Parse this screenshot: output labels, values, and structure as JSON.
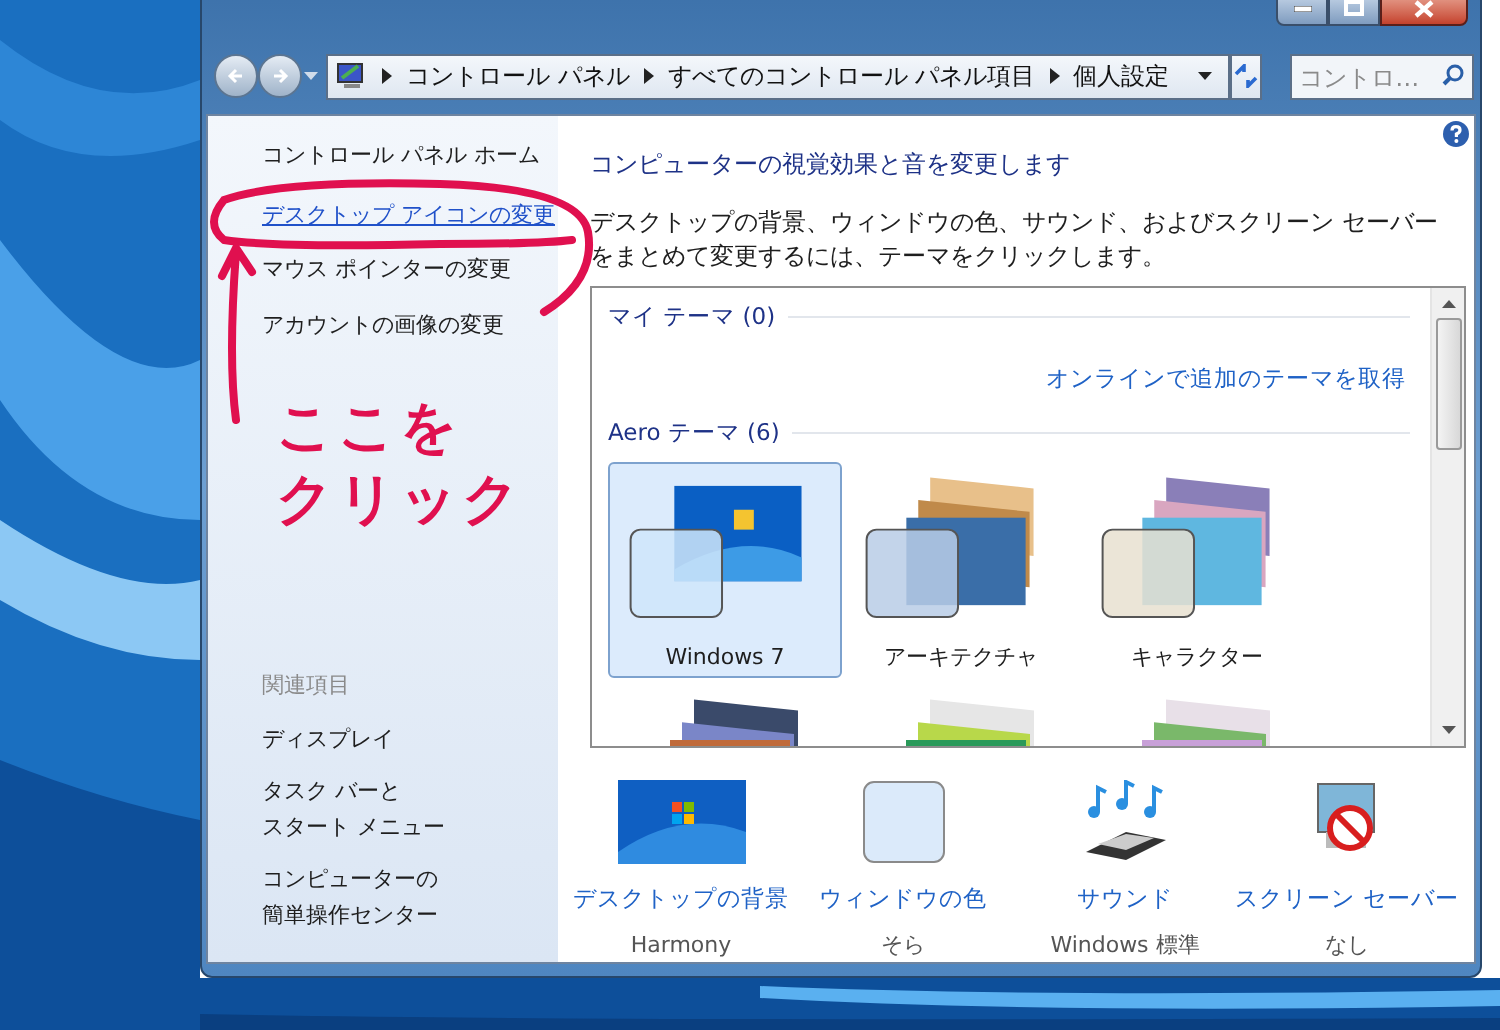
{
  "window": {
    "breadcrumb": [
      "コントロール パネル",
      "すべてのコントロール パネル項目",
      "個人設定"
    ],
    "search": {
      "placeholder": "コントロ…"
    }
  },
  "sidebar": {
    "home_link": "コントロール パネル ホーム",
    "tasks": [
      {
        "label": "デスクトップ アイコンの変更",
        "hovered": true
      },
      {
        "label": "マウス ポインターの変更",
        "hovered": false
      },
      {
        "label": "アカウントの画像の変更",
        "hovered": false
      }
    ],
    "related": {
      "heading": "関連項目",
      "links": [
        {
          "lines": [
            "ディスプレイ"
          ]
        },
        {
          "lines": [
            "タスク バーと",
            "スタート メニュー"
          ]
        },
        {
          "lines": [
            "コンピューターの",
            "簡単操作センター"
          ]
        }
      ]
    }
  },
  "main": {
    "title": "コンピューターの視覚効果と音を変更します",
    "description": "デスクトップの背景、ウィンドウの色、サウンド、およびスクリーン セーバーをまとめて変更するには、テーマをクリックします。",
    "my_themes_heading": "マイ テーマ (0)",
    "online_link": "オンラインで追加のテーマを取得",
    "aero_heading": "Aero テーマ (6)",
    "themes": [
      {
        "name": "Windows 7",
        "selected": true
      },
      {
        "name": "アーキテクチャ",
        "selected": false
      },
      {
        "name": "キャラクター",
        "selected": false
      },
      {
        "selected": false
      },
      {
        "selected": false
      },
      {
        "selected": false
      }
    ]
  },
  "settings": [
    {
      "kind": "background",
      "label": "デスクトップの背景",
      "value": "Harmony"
    },
    {
      "kind": "color",
      "label": "ウィンドウの色",
      "value": "そら"
    },
    {
      "kind": "sound",
      "label": "サウンド",
      "value": "Windows 標準"
    },
    {
      "kind": "screensaver",
      "label": "スクリーン セーバー",
      "value": "なし"
    }
  ],
  "annotation": {
    "lines": [
      "ここを",
      "クリック"
    ]
  }
}
